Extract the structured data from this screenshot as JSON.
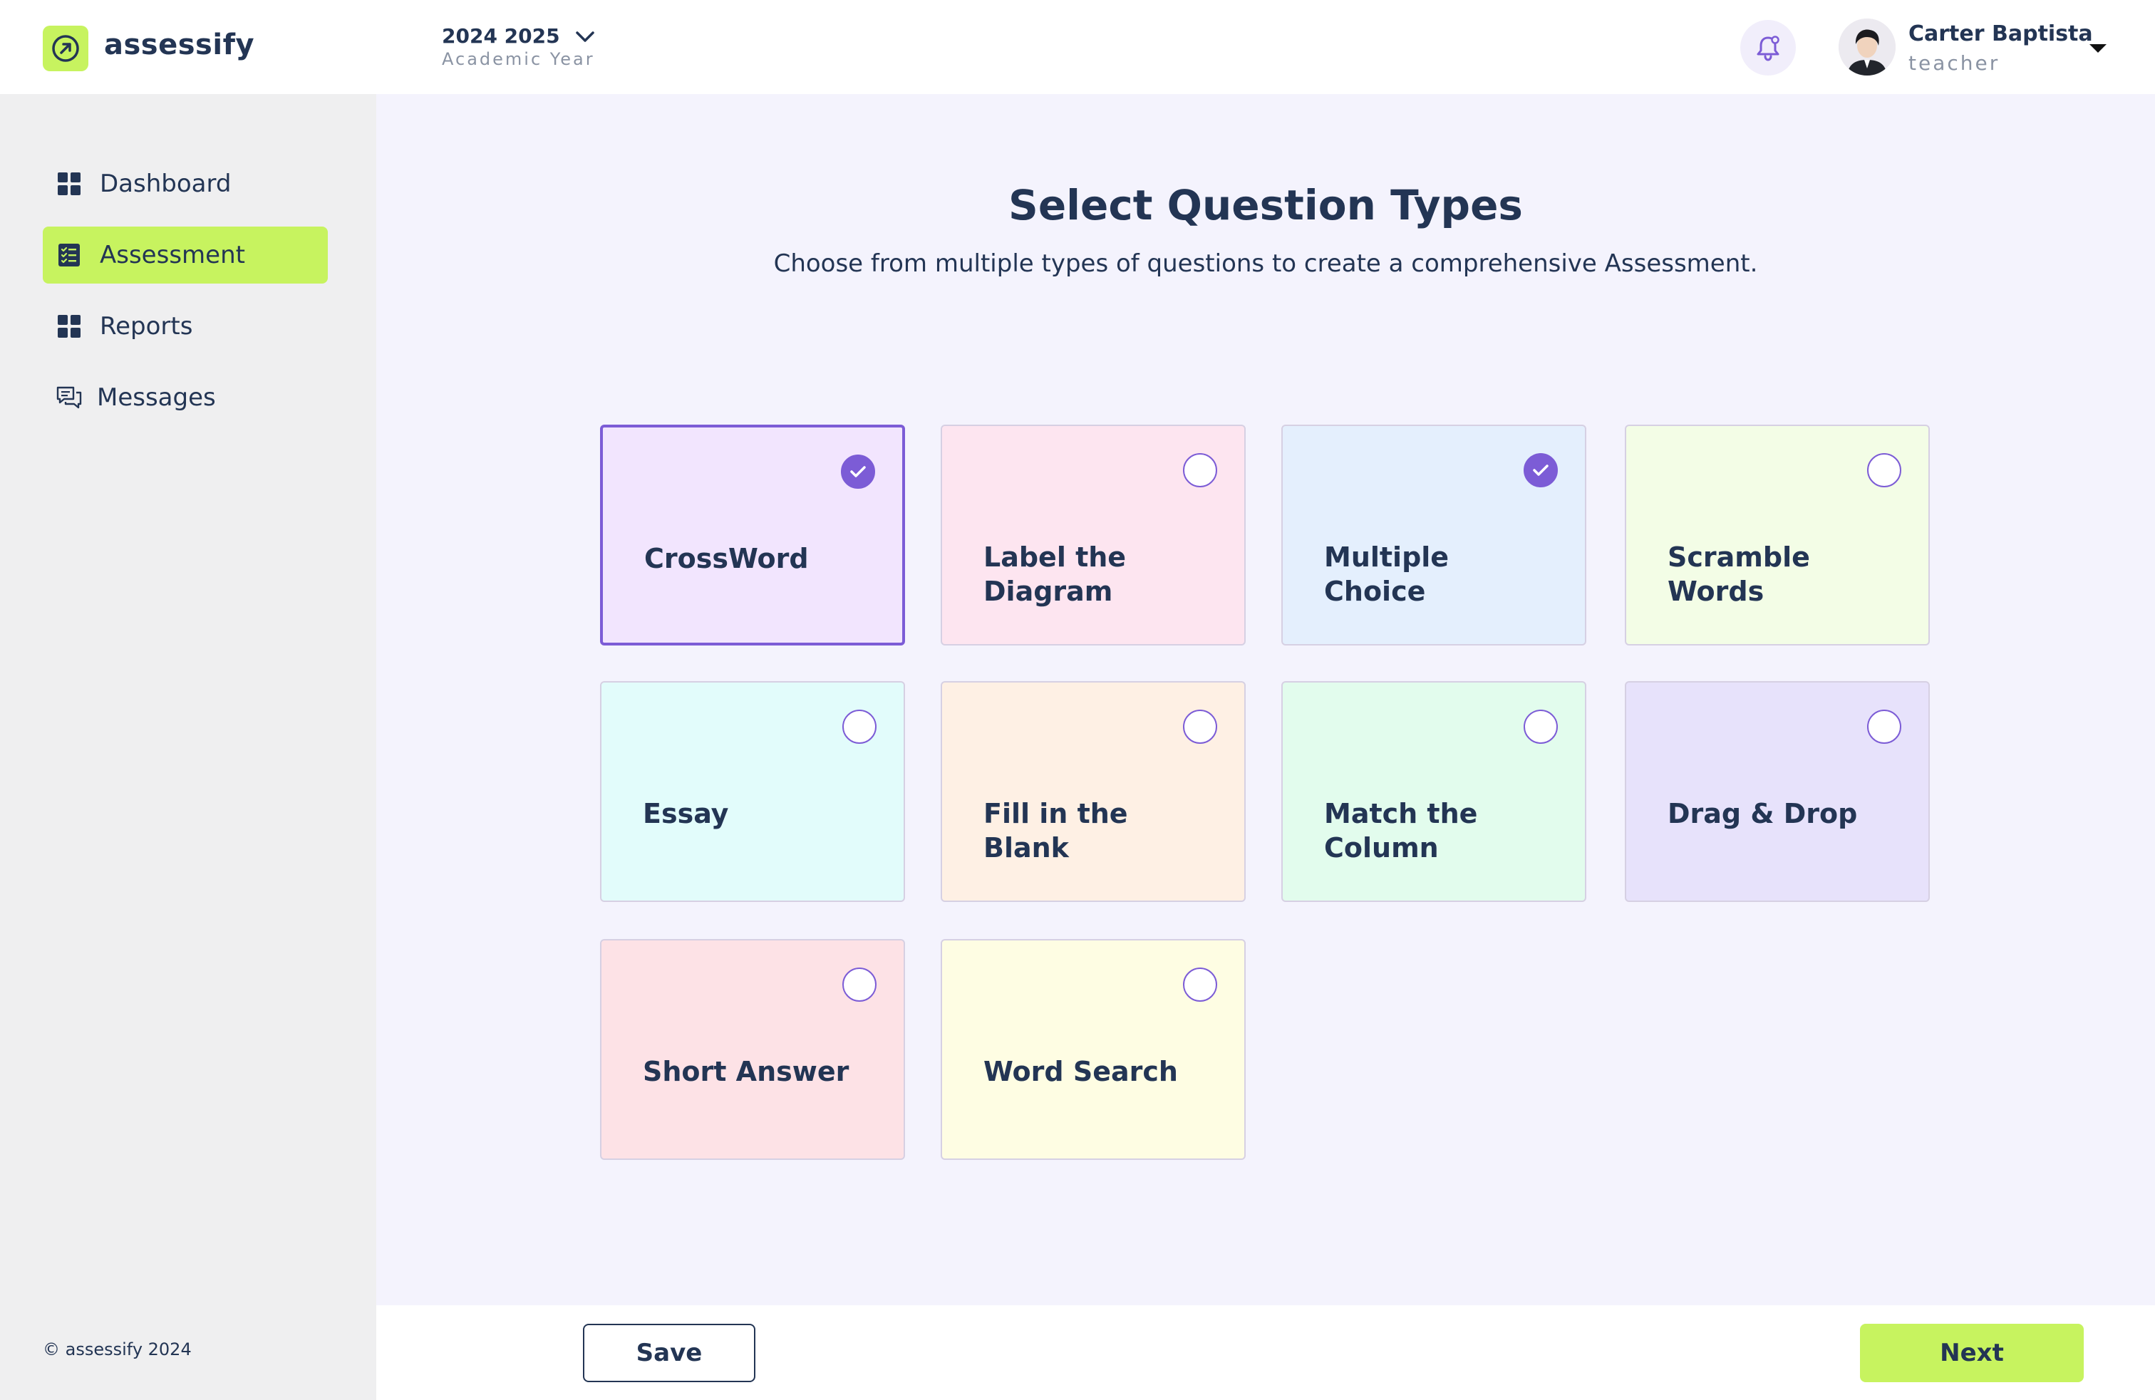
{
  "app": {
    "name": "assessify",
    "brand_color": "#c7f35f",
    "accent_color": "#7c5cd6"
  },
  "header": {
    "year_title": "2024 2025",
    "year_subtitle": "Academic Year",
    "user_name": "Carter Baptista",
    "user_role": "teacher"
  },
  "sidebar": {
    "items": [
      {
        "label": "Dashboard",
        "icon": "grid-icon",
        "active": false
      },
      {
        "label": "Assessment",
        "icon": "checklist-icon",
        "active": true
      },
      {
        "label": "Reports",
        "icon": "grid-icon",
        "active": false
      },
      {
        "label": "Messages",
        "icon": "chat-icon",
        "active": false
      }
    ],
    "copyright": "© assessify 2024"
  },
  "main": {
    "title": "Select Question Types",
    "subtitle": "Choose from multiple types of questions to create a comprehensive Assessment.",
    "question_types": [
      {
        "label": "CrossWord",
        "selected": true,
        "color": "#f2e5fe"
      },
      {
        "label": "Label the Diagram",
        "selected": false,
        "color": "#fde5f0"
      },
      {
        "label": "Multiple Choice",
        "selected": true,
        "color": "#e4effd"
      },
      {
        "label": "Scramble Words",
        "selected": false,
        "color": "#f3fde6"
      },
      {
        "label": "Essay",
        "selected": false,
        "color": "#e2fcfb"
      },
      {
        "label": "Fill in the Blank",
        "selected": false,
        "color": "#fef0e4"
      },
      {
        "label": "Match the Column",
        "selected": false,
        "color": "#e2fced"
      },
      {
        "label": "Drag & Drop",
        "selected": false,
        "color": "#e7e2fb"
      },
      {
        "label": "Short Answer",
        "selected": false,
        "color": "#fde2e6"
      },
      {
        "label": "Word Search",
        "selected": false,
        "color": "#fefde3"
      }
    ]
  },
  "footer": {
    "save_label": "Save",
    "next_label": "Next"
  }
}
